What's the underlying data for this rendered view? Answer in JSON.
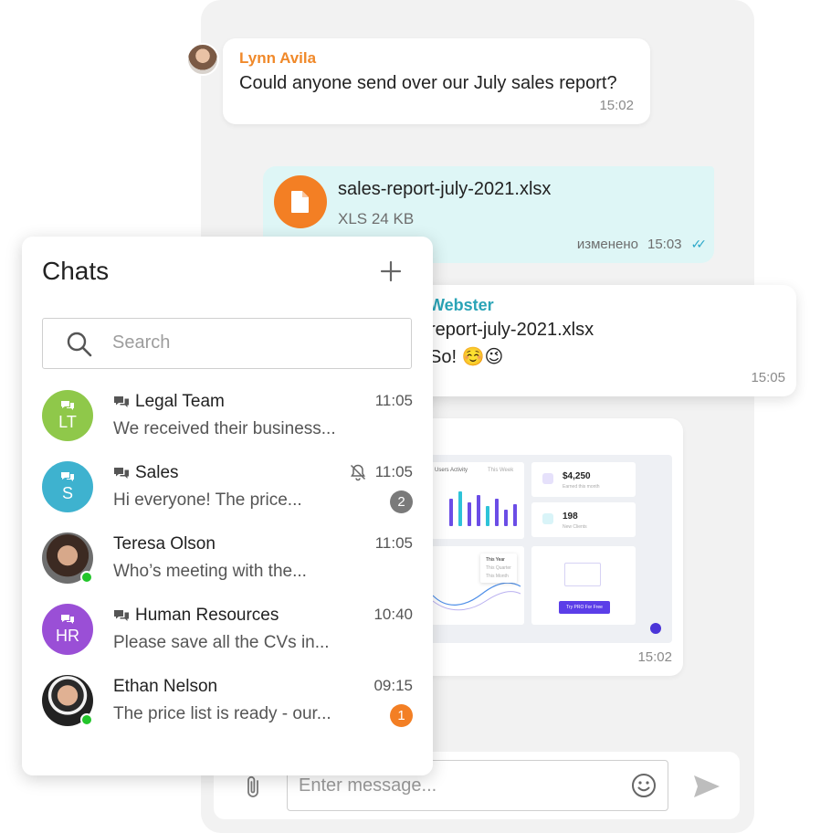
{
  "thread": {
    "msg1": {
      "author": "Lynn Avila",
      "text": "Could anyone send over our July sales report?",
      "time": "15:02"
    },
    "msg2": {
      "file_name": "sales-report-july-2021.xlsx",
      "file_meta": "XLS 24 KB",
      "edited": "изменено",
      "time": "15:03",
      "status_icon": "double-check-icon"
    },
    "msg3": {
      "author": "Webster",
      "file_ref": "report-july-2021.xlsx",
      "text": "So!  ☺️😉",
      "time": "15:05"
    },
    "msg4": {
      "time": "15:02",
      "preview": {
        "activity_title": "Users Activity",
        "period": "This Week",
        "stat1_value": "$4,250",
        "stat1_label": "Earned this month",
        "stat2_value": "198",
        "stat2_label": "New Clients",
        "tooltip_year": "This Year",
        "tooltip_quarter": "This Quarter",
        "tooltip_month": "This Month",
        "cta": "Try PRO For Free"
      }
    }
  },
  "composer": {
    "placeholder": "Enter message...",
    "attach_icon": "paperclip-icon",
    "emoji_icon": "smiley-icon",
    "send_icon": "send-icon"
  },
  "chats": {
    "title": "Chats",
    "add_icon": "plus-icon",
    "search_placeholder": "Search",
    "items": [
      {
        "name": "Legal Team",
        "group": true,
        "initials": "LT",
        "avatar_color": "#8fc84a",
        "time": "11:05",
        "preview": "We received their business..."
      },
      {
        "name": "Sales",
        "group": true,
        "initials": "S",
        "avatar_color": "#3eb2cf",
        "time": "11:05",
        "muted": true,
        "preview": "Hi everyone! The price...",
        "unread": "2",
        "unread_color": "#7a7a7a"
      },
      {
        "name": "Teresa Olson",
        "group": false,
        "time": "11:05",
        "preview": "Who’s meeting with the...",
        "online": true
      },
      {
        "name": "Human Resources",
        "group": true,
        "initials": "HR",
        "avatar_color": "#9a4fd6",
        "time": "10:40",
        "preview": "Please save all the CVs in..."
      },
      {
        "name": "Ethan Nelson",
        "group": false,
        "time": "09:15",
        "preview": "The price list is ready - our...",
        "online": true,
        "unread": "1",
        "unread_color": "#f37f24"
      }
    ]
  }
}
